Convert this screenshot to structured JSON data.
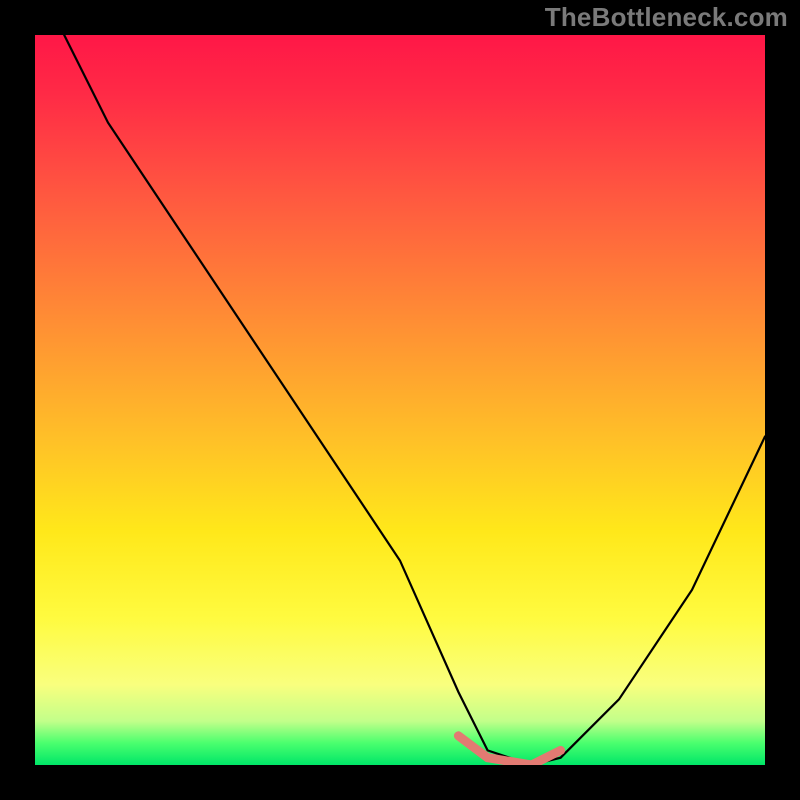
{
  "watermark": "TheBottleneck.com",
  "chart_data": {
    "type": "line",
    "title": "",
    "xlabel": "",
    "ylabel": "",
    "xlim": [
      0,
      100
    ],
    "ylim": [
      0,
      100
    ],
    "grid": false,
    "legend": false,
    "series": [
      {
        "name": "bottleneck-curve",
        "type": "line",
        "color": "#000000",
        "x": [
          4,
          10,
          20,
          30,
          40,
          50,
          58,
          62,
          68,
          72,
          80,
          90,
          100
        ],
        "values": [
          100,
          88,
          73,
          58,
          43,
          28,
          10,
          2,
          0,
          1,
          9,
          24,
          45
        ]
      },
      {
        "name": "optimal-range-highlight",
        "type": "line",
        "color": "#e27a72",
        "x": [
          58,
          62,
          68,
          72
        ],
        "values": [
          4,
          1,
          0,
          2
        ]
      }
    ],
    "gradient_stops": [
      {
        "pos": 0.0,
        "color": "#ff1747"
      },
      {
        "pos": 0.08,
        "color": "#ff2a46"
      },
      {
        "pos": 0.22,
        "color": "#ff5840"
      },
      {
        "pos": 0.38,
        "color": "#ff8a35"
      },
      {
        "pos": 0.55,
        "color": "#ffbf28"
      },
      {
        "pos": 0.68,
        "color": "#ffe81a"
      },
      {
        "pos": 0.8,
        "color": "#fffb40"
      },
      {
        "pos": 0.89,
        "color": "#f9ff7e"
      },
      {
        "pos": 0.94,
        "color": "#c2ff8a"
      },
      {
        "pos": 0.97,
        "color": "#4aff6e"
      },
      {
        "pos": 1.0,
        "color": "#00e668"
      }
    ]
  }
}
